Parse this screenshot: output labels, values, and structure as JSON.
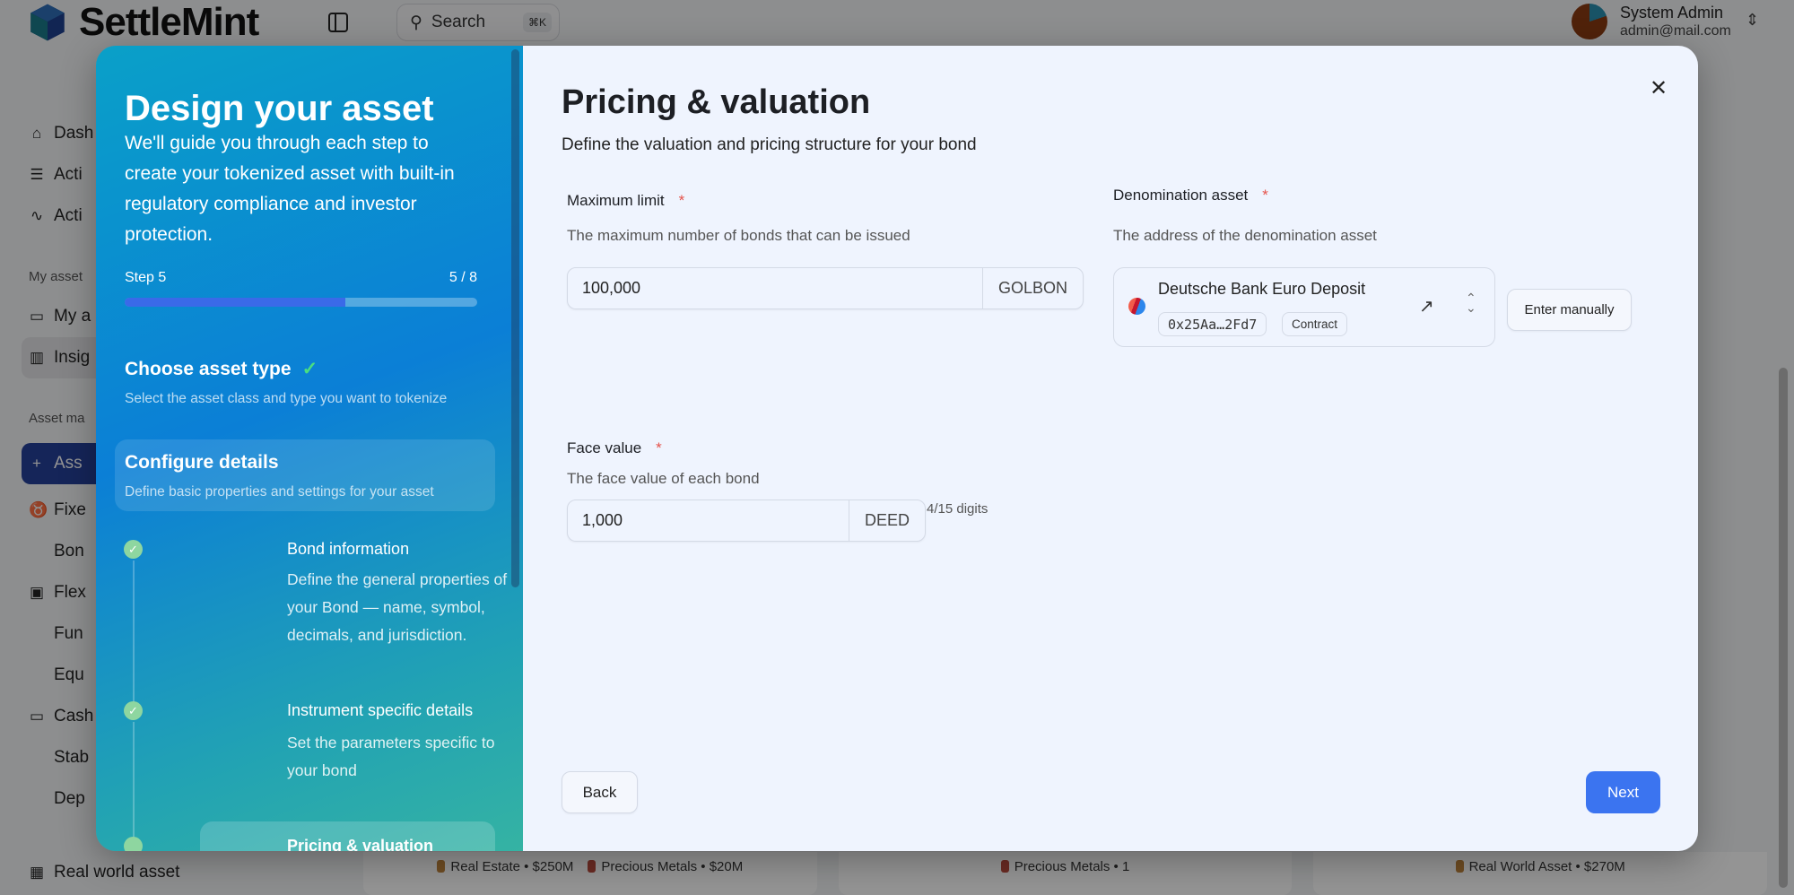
{
  "app": {
    "brand": "SettleMint",
    "search": {
      "label": "Search",
      "shortcut": "⌘K"
    },
    "user": {
      "name": "System Admin",
      "email": "admin@mail.com"
    },
    "sidebar": {
      "items": [
        {
          "label": "Dash",
          "icon": "home-icon"
        },
        {
          "label": "Acti",
          "icon": "checklist-icon"
        },
        {
          "label": "Acti",
          "icon": "activity-icon"
        }
      ],
      "my_assets_section": "My asset",
      "my_assets_items": [
        {
          "label": "My a",
          "icon": "wallet-icon"
        },
        {
          "label": "Insig",
          "icon": "chart-icon",
          "active": true
        }
      ],
      "asset_section": "Asset ma",
      "add_button": "Ass",
      "groups": [
        {
          "label": "Fixe",
          "icon": "piggy-bank-icon",
          "children": [
            "Bon"
          ]
        },
        {
          "label": "Flex",
          "icon": "cash-up-icon",
          "children": [
            "Fun",
            "Equ"
          ]
        },
        {
          "label": "Cash",
          "icon": "card-icon",
          "children": [
            "Stab",
            "Dep"
          ]
        },
        {
          "label": "Real world asset",
          "icon": "building-icon",
          "children": []
        }
      ]
    },
    "cards": [
      {
        "legend": [
          {
            "label": "Real Estate • $250M",
            "color": "#c0843c"
          },
          {
            "label": "Precious Metals • $20M",
            "color": "#b84a3c"
          }
        ]
      },
      {
        "legend": [
          {
            "label": "Precious Metals • 1",
            "color": "#b84a3c"
          }
        ]
      },
      {
        "legend": [
          {
            "label": "Real World Asset • $270M",
            "color": "#c0843c"
          }
        ]
      }
    ]
  },
  "wizard": {
    "title": "Design your asset",
    "description": "We'll guide you through each step to create your tokenized asset with built-in regulatory compliance and investor protection.",
    "step_label": "Step 5",
    "step_count": "5 / 8",
    "progress": 0.625,
    "groups": [
      {
        "title": "Choose asset type",
        "subtitle": "Select the asset class and type you want to tokenize",
        "completed": true
      },
      {
        "title": "Configure details",
        "subtitle": "Define basic properties and settings for your asset",
        "active": true
      }
    ],
    "substeps": [
      {
        "title": "Bond information",
        "description": "Define the general properties of your Bond — name, symbol, decimals, and jurisdiction.",
        "completed": true
      },
      {
        "title": "Instrument specific details",
        "description": "Set the parameters specific to your bond",
        "completed": true
      },
      {
        "title": "Pricing & valuation",
        "current": true
      }
    ]
  },
  "form": {
    "title": "Pricing & valuation",
    "subtitle": "Define the valuation and pricing structure for your bond",
    "max_limit": {
      "label": "Maximum limit",
      "required": "*",
      "hint": "The maximum number of bonds that can be issued",
      "value": "100,000",
      "addon": "GOLBON"
    },
    "face_value": {
      "label": "Face value",
      "required": "*",
      "hint": "The face value of each bond",
      "value": "1,000",
      "addon": "DEED",
      "counter": "4/15 digits"
    },
    "denomination": {
      "label": "Denomination asset",
      "required": "*",
      "hint": "The address of the denomination asset",
      "name": "Deutsche Bank Euro Deposit",
      "address": "0x25Aa…2Fd7",
      "badge": "Contract",
      "enter_manually": "Enter manually"
    },
    "back": "Back",
    "next": "Next",
    "accent": "#3b74f0"
  }
}
